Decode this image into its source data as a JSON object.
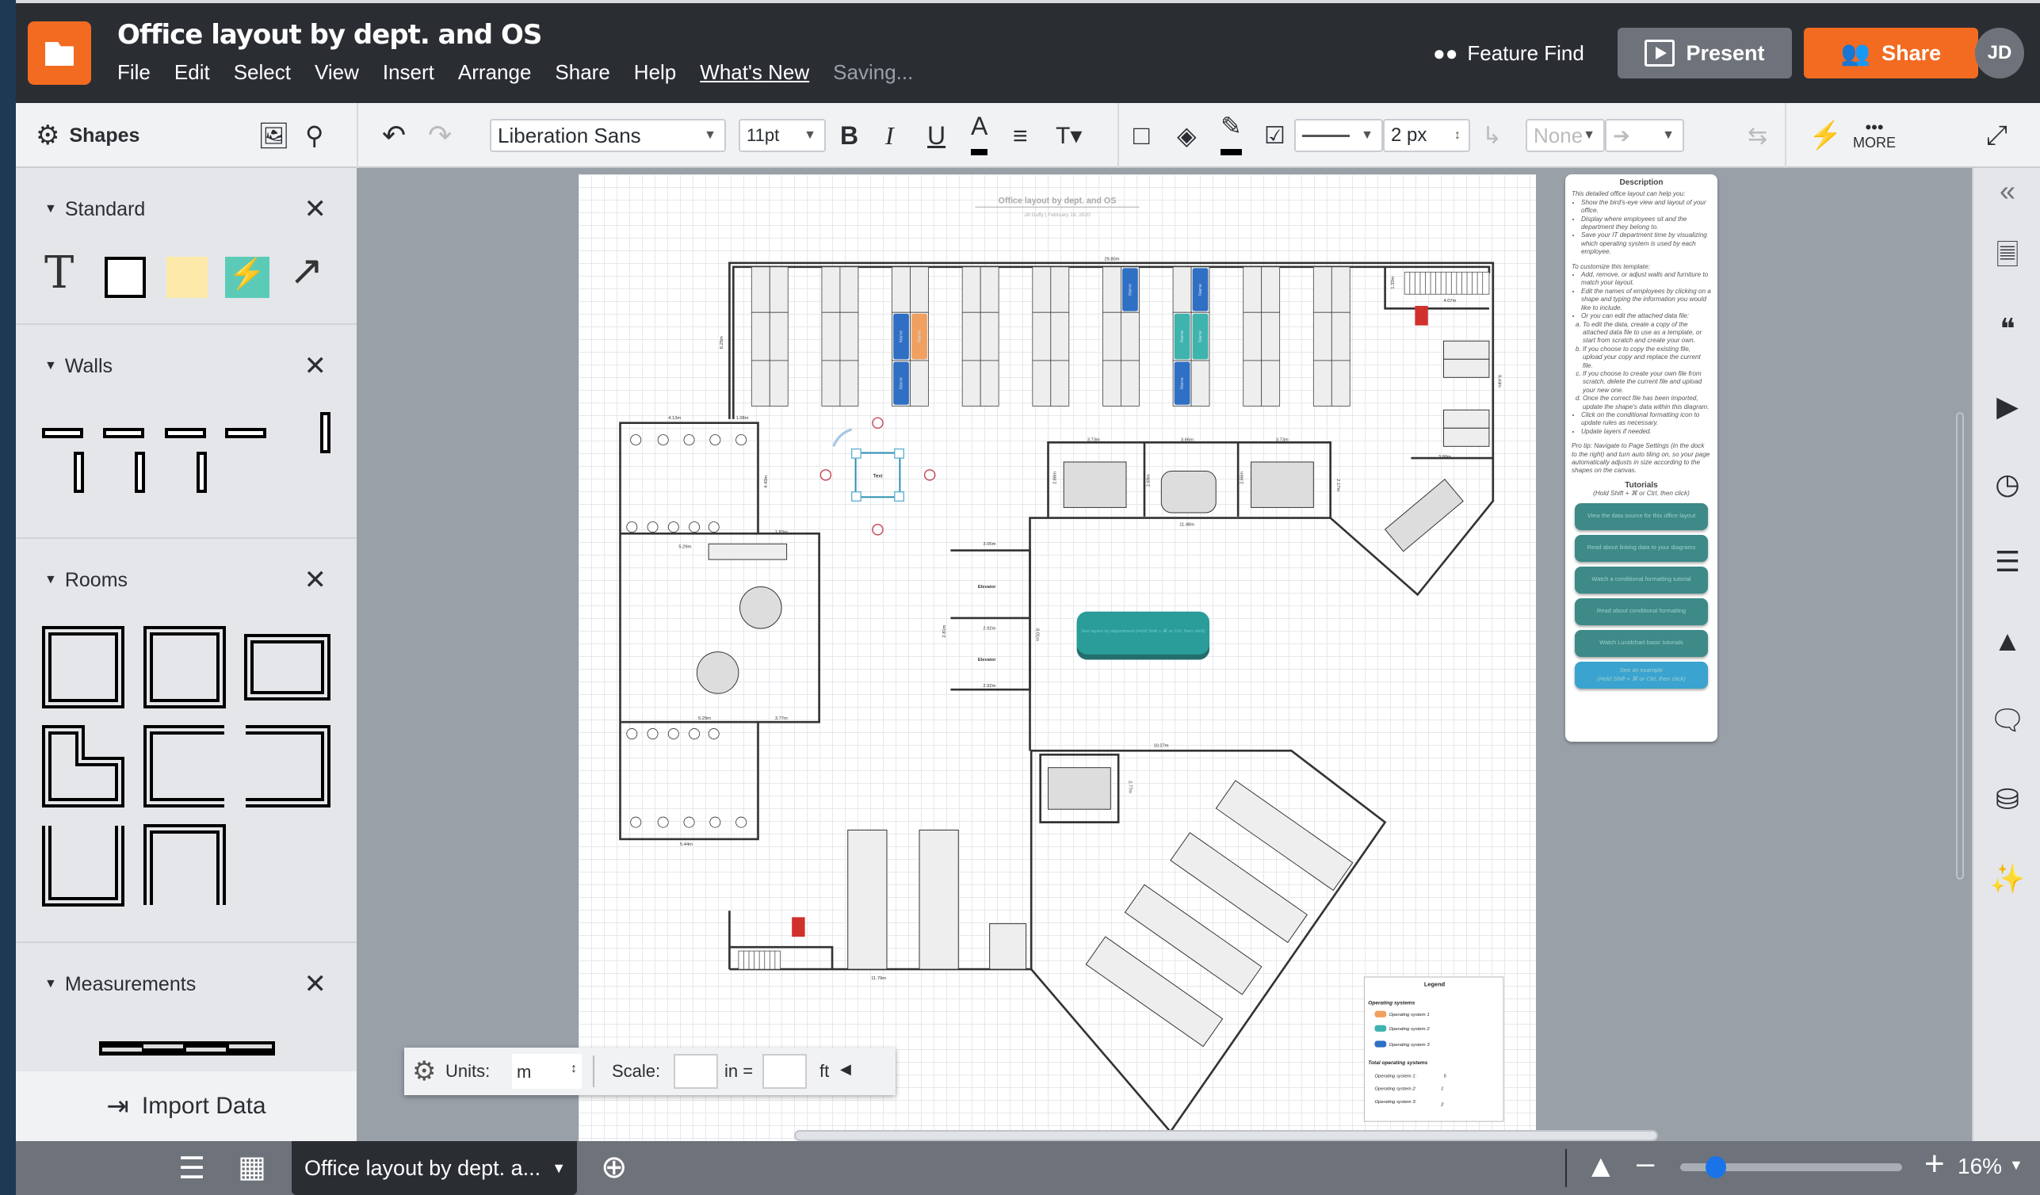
{
  "app": {
    "title": "Office layout by dept. and OS",
    "menu": [
      "File",
      "Edit",
      "Select",
      "View",
      "Insert",
      "Arrange",
      "Share",
      "Help",
      "What's New"
    ],
    "status": "Saving...",
    "feature_find": "Feature Find",
    "present": "Present",
    "share": "Share",
    "avatar": "JD",
    "accent_color": "#f26b21"
  },
  "toolbar": {
    "shapes_label": "Shapes",
    "font": "Liberation Sans",
    "font_size": "11pt",
    "line_width": "2 px",
    "endpoint": "None",
    "more": "MORE",
    "icons": [
      "gear-icon",
      "image-icon",
      "search-icon",
      "undo-icon",
      "redo-icon",
      "bold-icon",
      "italic-icon",
      "underline-icon",
      "text-color-icon",
      "align-icon",
      "text-options-icon",
      "container-icon",
      "fill-icon",
      "line-color-icon",
      "conditional-format-icon",
      "connector-icon",
      "swap-icon",
      "lightning-icon",
      "fullscreen-icon"
    ]
  },
  "left_panel": {
    "sections": [
      {
        "name": "Standard"
      },
      {
        "name": "Walls"
      },
      {
        "name": "Rooms"
      },
      {
        "name": "Measurements"
      }
    ],
    "import_data": "Import Data"
  },
  "diagram": {
    "title": "Office layout by dept. and OS",
    "subtitle": "Jill Duffy  |  February 18, 2020",
    "desk_label": "Name",
    "selected_text": "Text",
    "elevator_label": "Elevator",
    "measurements": [
      "29.80m",
      "6.25m",
      "1.33m",
      "4.07m",
      "9.44m",
      "3.90m",
      "3.73m",
      "3.66m",
      "3.73m",
      "2.66m",
      "2.69m",
      "2.66m",
      "2.17m",
      "11.48m",
      "1.08m",
      "4.13m",
      "4.43m",
      "1.83m",
      "3.05m",
      "2.92m",
      "2.92m",
      "2.81m",
      "8.01m",
      "5.29m",
      "5.29m",
      "3.77m",
      "10.27m",
      "5.44m",
      "2.77m",
      "11.79m"
    ],
    "teal_button": "See layout by department (Hold Shift + ⌘ or Ctrl, then click)",
    "os_colors": {
      "os1": "#f0a060",
      "os2": "#3fb3ad",
      "os3": "#2f6fc4"
    },
    "legend": {
      "title": "Legend",
      "os_heading": "Operating systems",
      "items": [
        "Operating system 1",
        "Operating system 2",
        "Operating system 3"
      ],
      "totals_heading": "Total operating systems",
      "totals": [
        {
          "label": "Operating system 1:",
          "value": "5"
        },
        {
          "label": "Operating system 2:",
          "value": "1"
        },
        {
          "label": "Operating system 3:",
          "value": "2"
        }
      ]
    }
  },
  "description": {
    "title": "Description",
    "intro": "This detailed office layout can help you:",
    "bullets": [
      "Show the bird's-eye view and layout of your office.",
      "Display where employees sit and the department they belong to.",
      "Save your IT department time by visualizing which operating system is used by each employee."
    ],
    "customize": "To customize this template:",
    "steps": [
      "Add, remove, or adjust walls and furniture to match your layout.",
      "Edit the names of employees by clicking on a shape and typing the information you would like to include.",
      "Or you can edit the attached data file:"
    ],
    "substeps": [
      "To edit the data, create a copy of the attached data file to use as a template, or start from scratch and create your own.",
      "If you choose to copy the existing file, upload your copy and replace the current file.",
      "If you choose to create your own file from scratch, delete the current file and upload your new one.",
      "Once the correct file has been imported, update the shape's data within this diagram."
    ],
    "steps2": [
      "Click on the conditional formatting icon to update rules as necessary.",
      "Update layers if needed."
    ],
    "pro_tip": "Pro tip: Navigate to Page Settings (in the dock to the right) and turn auto tiling on, so your page automatically adjusts in size according to the shapes on the canvas.",
    "tutorials_title": "Tutorials",
    "tutorials_hint": "(Hold Shift + ⌘ or Ctrl, then click)",
    "tutorials": [
      "View the data source for this office layout",
      "Read about linking data to your diagrams",
      "Watch a conditional formatting tutorial",
      "Read about conditional formatting",
      "Watch Lucidchart basic tutorials"
    ],
    "example": "See an example",
    "example_hint": "(Hold Shift + ⌘ or Ctrl, then click)"
  },
  "units_bar": {
    "units_label": "Units:",
    "units_value": "m",
    "scale_label": "Scale:",
    "in_label": "in =",
    "ft_label": "ft",
    "scale_in": "",
    "scale_ft": ""
  },
  "bottom": {
    "page_tab": "Office layout by dept. a...",
    "zoom": "16%",
    "zoom_slider_fraction": 0.16
  },
  "dock_icons": [
    "collapse-icon",
    "page-settings-icon",
    "comments-quote-icon",
    "presentation-icon",
    "history-icon",
    "layers-icon",
    "data-icon",
    "chat-icon",
    "data-link-icon",
    "magic-icon"
  ]
}
